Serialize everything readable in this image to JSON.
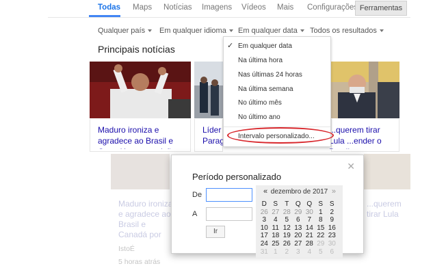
{
  "nav": {
    "tabs": [
      "Todas",
      "Maps",
      "Notícias",
      "Imagens",
      "Vídeos",
      "Mais",
      "Configurações"
    ],
    "tools_label": "Ferramentas"
  },
  "filters": [
    "Qualquer país",
    "Em qualquer idioma",
    "Em qualquer data",
    "Todos os resultados"
  ],
  "section_title": "Principais notícias",
  "cards": [
    {
      "headline": "Maduro ironiza e agradece ao Brasil e Canadá por expulsão"
    },
    {
      "headline": "Líder Parag... ao Brasil"
    },
    {
      "headline": "...querem tirar Lula ...ender o Brasil"
    }
  ],
  "date_menu": {
    "items": [
      "Em qualquer data",
      "Na última hora",
      "Nas últimas 24 horas",
      "Na última semana",
      "No último mês",
      "No último ano"
    ],
    "custom": "Intervalo personalizado...",
    "highlight_color": "#d8262b"
  },
  "background": {
    "headline_left": "Maduro ironiza e agradece ao Brasil e Canadá por expulsão de diplomatas",
    "source": "IstoÉ",
    "time": "5 horas atrás",
    "headline_right": "...querem tirar Lula ...ender o Brasil"
  },
  "custom_range": {
    "title": "Período personalizado",
    "from_label": "De",
    "to_label": "A",
    "from_value": "",
    "to_value": "",
    "submit_label": "Ir",
    "calendar": {
      "month": "dezembro de 2017",
      "prev": "«",
      "next": "»",
      "weekdays": [
        "D",
        "S",
        "T",
        "Q",
        "Q",
        "S",
        "S"
      ],
      "weeks": [
        [
          "26",
          "27",
          "28",
          "29",
          "30",
          "1",
          "2"
        ],
        [
          "3",
          "4",
          "5",
          "6",
          "7",
          "8",
          "9"
        ],
        [
          "10",
          "11",
          "12",
          "13",
          "14",
          "15",
          "16"
        ],
        [
          "17",
          "18",
          "19",
          "20",
          "21",
          "22",
          "23"
        ],
        [
          "24",
          "25",
          "26",
          "27",
          "28",
          "29",
          "30"
        ],
        [
          "31",
          "1",
          "2",
          "3",
          "4",
          "5",
          "6"
        ]
      ]
    }
  }
}
